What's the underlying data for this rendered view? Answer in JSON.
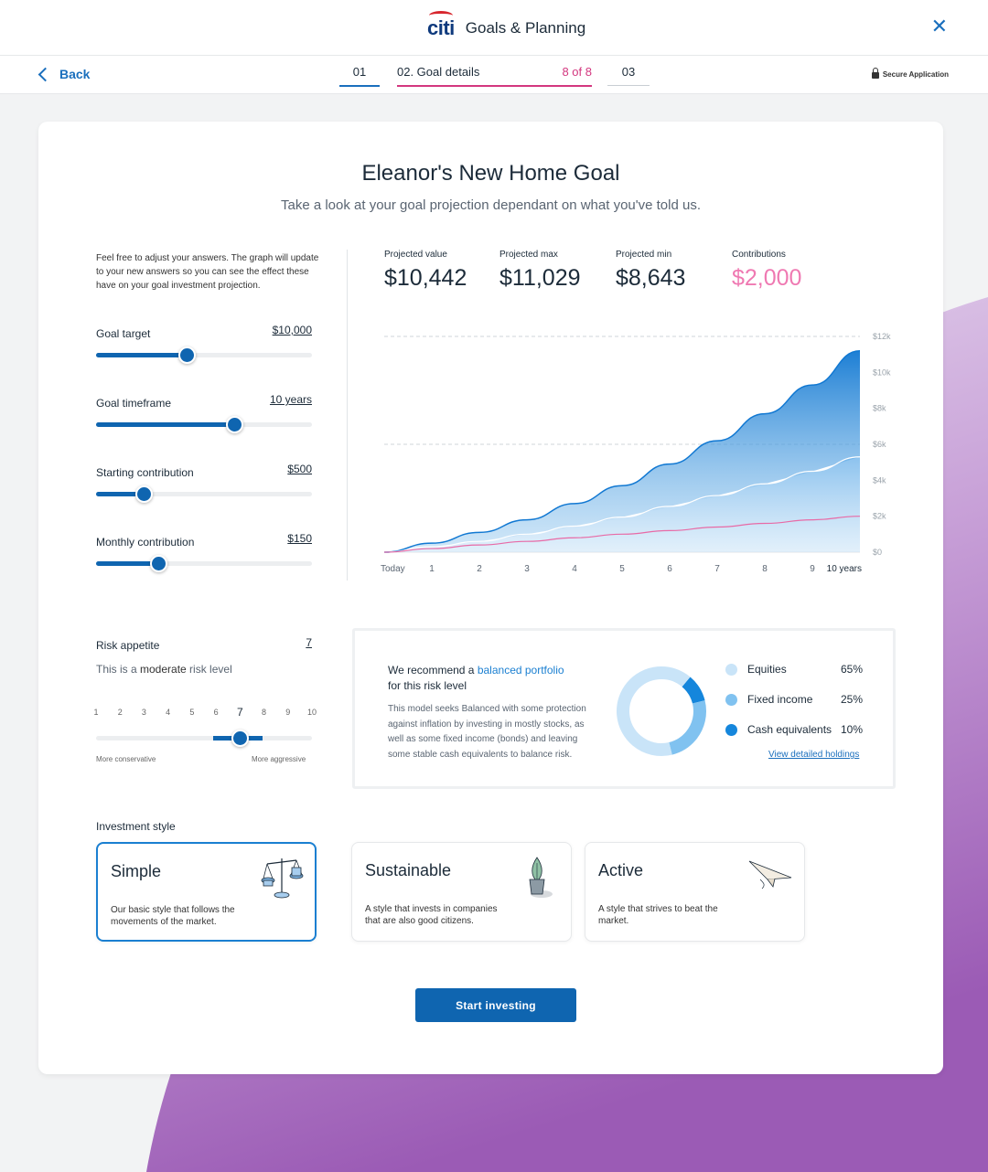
{
  "header": {
    "brand": "citi",
    "title": "Goals & Planning",
    "close_icon": "close-icon"
  },
  "steps": {
    "back_label": "Back",
    "step1": "01",
    "step2_label": "02. Goal details",
    "step2_count": "8 of 8",
    "step3": "03",
    "secure_label": "Secure Application"
  },
  "colors": {
    "primary": "#0f65b0",
    "accent_pink": "#d3377f",
    "link": "#1a7fd1",
    "bg_purple": "#9b5bb5"
  },
  "goal": {
    "title": "Eleanor's New Home Goal",
    "subtitle": "Take a look at your goal projection dependant on what you've told us.",
    "intro": "Feel free to adjust your answers. The graph will update to your new answers so you can see the effect these have on your goal investment projection."
  },
  "sliders": [
    {
      "label": "Goal target",
      "value": "$10,000",
      "fill": 0.42
    },
    {
      "label": "Goal timeframe",
      "value": "10 years",
      "fill": 0.64
    },
    {
      "label": "Starting contribution",
      "value": "$500",
      "fill": 0.22
    },
    {
      "label": "Monthly contribution",
      "value": "$150",
      "fill": 0.29
    }
  ],
  "stats": [
    {
      "label": "Projected value",
      "value": "$10,442"
    },
    {
      "label": "Projected max",
      "value": "$11,029"
    },
    {
      "label": "Projected min",
      "value": "$8,643"
    },
    {
      "label": "Contributions",
      "value": "$2,000"
    }
  ],
  "chart_data": {
    "type": "area",
    "x": [
      "Today",
      "1",
      "2",
      "3",
      "4",
      "5",
      "6",
      "7",
      "8",
      "9",
      "10 years"
    ],
    "y_ticks": [
      "$0",
      "$2k",
      "$4k",
      "$6k",
      "$8k",
      "$10k",
      "$12k"
    ],
    "ylim": [
      0,
      12000
    ],
    "series": [
      {
        "color": "#1178d2",
        "values": [
          0,
          500,
          1100,
          1800,
          2700,
          3700,
          4900,
          6200,
          7700,
          9300,
          11200
        ]
      },
      {
        "color": "#8ec5ee",
        "values": [
          0,
          300,
          600,
          1000,
          1450,
          1950,
          2550,
          3150,
          3800,
          4500,
          5300
        ]
      },
      {
        "color": "#e86aa6",
        "values": [
          0,
          200,
          400,
          600,
          800,
          1000,
          1200,
          1400,
          1600,
          1800,
          2000
        ]
      }
    ],
    "max_line": 12000,
    "grid": "dashed at max and $6k"
  },
  "risk": {
    "label": "Risk appetite",
    "value": "7",
    "desc_prefix": "This is a ",
    "desc_level": "moderate",
    "desc_suffix": " risk level",
    "scale": [
      "1",
      "2",
      "3",
      "4",
      "5",
      "6",
      "7",
      "8",
      "9",
      "10"
    ],
    "selected": 7,
    "left_end": "More conservative",
    "right_end": "More aggressive"
  },
  "recommendation": {
    "prefix": "We recommend a ",
    "link": "balanced portfolio",
    "suffix": "for this risk level",
    "body": "This model seeks Balanced with some protection against inflation by investing in mostly stocks, as well as some fixed income (bonds) and leaving some stable cash equivalents to balance risk.",
    "allocations": [
      {
        "name": "Equities",
        "pct": "65%",
        "value": 65,
        "color": "#c9e4f8"
      },
      {
        "name": "Fixed income",
        "pct": "25%",
        "value": 25,
        "color": "#80c2f0"
      },
      {
        "name": "Cash equivalents",
        "pct": "10%",
        "value": 10,
        "color": "#1586dc"
      }
    ],
    "holdings_link": "View detailed holdings"
  },
  "investment_style": {
    "label": "Investment style",
    "options": [
      {
        "name": "Simple",
        "desc": "Our basic style that follows the movements of the market.",
        "icon": "scales-icon",
        "selected": true
      },
      {
        "name": "Sustainable",
        "desc": "A style that invests in companies that are also good citizens.",
        "icon": "plant-icon",
        "selected": false
      },
      {
        "name": "Active",
        "desc": "A style that strives to beat the market.",
        "icon": "paper-plane-icon",
        "selected": false
      }
    ]
  },
  "cta": {
    "label": "Start investing"
  }
}
